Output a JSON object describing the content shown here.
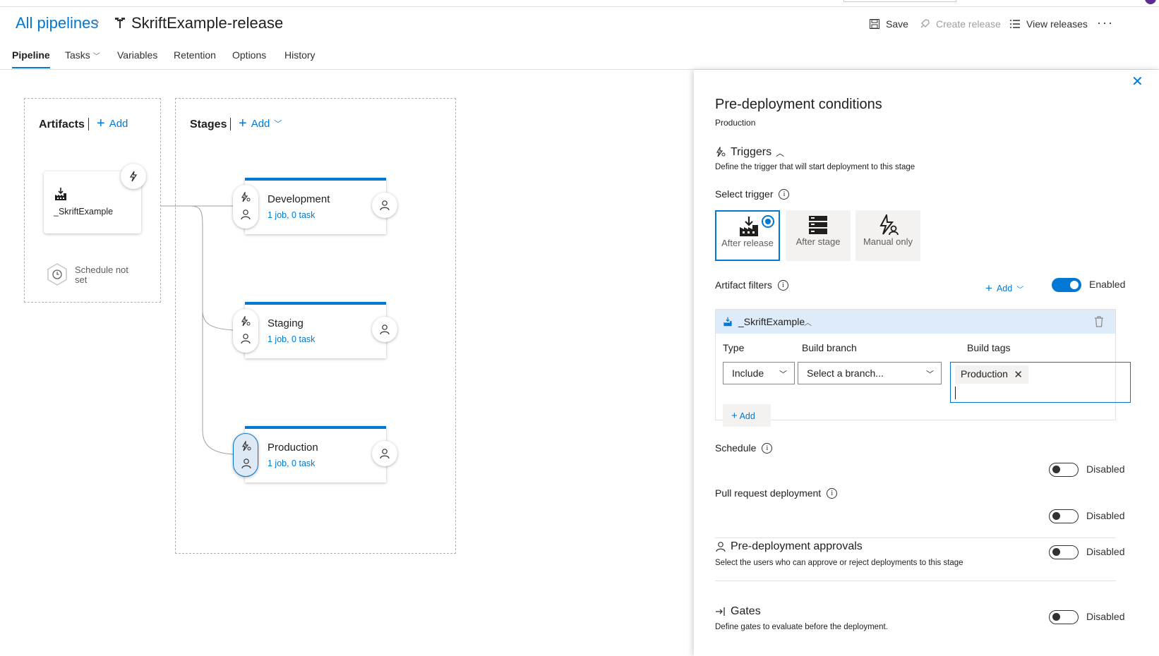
{
  "header": {
    "breadcrumb_root": "All pipelines",
    "pipeline_title": "SkriftExample-release",
    "save_label": "Save",
    "create_release_label": "Create release",
    "view_releases_label": "View releases",
    "more_label": "···"
  },
  "tabs": [
    {
      "label": "Pipeline",
      "active": true
    },
    {
      "label": "Tasks"
    },
    {
      "label": "Variables"
    },
    {
      "label": "Retention"
    },
    {
      "label": "Options"
    },
    {
      "label": "History"
    }
  ],
  "artifacts": {
    "title": "Artifacts",
    "add_label": "Add",
    "items": [
      {
        "name": "_SkriftExample"
      }
    ],
    "schedule_text": "Schedule not set"
  },
  "stages": {
    "title": "Stages",
    "add_label": "Add",
    "items": [
      {
        "name": "Development",
        "meta": "1 job, 0 task"
      },
      {
        "name": "Staging",
        "meta": "1 job, 0 task"
      },
      {
        "name": "Production",
        "meta": "1 job, 0 task",
        "selected": true
      }
    ]
  },
  "panel": {
    "title": "Pre-deployment conditions",
    "subtitle": "Production",
    "triggers": {
      "heading": "Triggers",
      "description": "Define the trigger that will start deployment to this stage",
      "select_label": "Select trigger",
      "options": [
        {
          "label": "After release",
          "selected": true
        },
        {
          "label": "After stage"
        },
        {
          "label": "Manual only"
        }
      ]
    },
    "artifact_filters": {
      "label": "Artifact filters",
      "add_label": "Add",
      "toggle_state": "Enabled",
      "artifact_name": "_SkriftExample",
      "col_type": "Type",
      "col_branch": "Build branch",
      "col_tags": "Build tags",
      "type_value": "Include",
      "branch_placeholder": "Select a branch...",
      "tags": [
        "Production"
      ],
      "row_add_label": "Add"
    },
    "schedule": {
      "label": "Schedule",
      "state": "Disabled"
    },
    "pull_request": {
      "label": "Pull request deployment",
      "state": "Disabled"
    },
    "approvals": {
      "heading": "Pre-deployment approvals",
      "description": "Select the users who can approve or reject deployments to this stage",
      "state": "Disabled"
    },
    "gates": {
      "heading": "Gates",
      "description": "Define gates to evaluate before the deployment.",
      "state": "Disabled"
    }
  },
  "colors": {
    "accent": "#0078d4",
    "selected_bg": "#deecf9"
  }
}
